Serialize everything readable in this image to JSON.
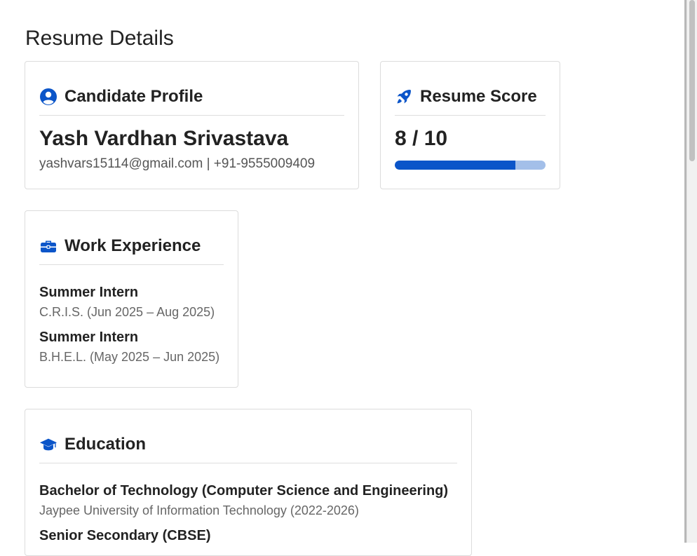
{
  "page": {
    "title": "Resume Details"
  },
  "profile": {
    "header": "Candidate Profile",
    "name": "Yash Vardhan Srivastava",
    "contact": "yashvars15114@gmail.com | +91-9555009409"
  },
  "score": {
    "header": "Resume Score",
    "text": "8 / 10",
    "value": 8,
    "max": 10,
    "colors": {
      "fill": "#0b55c9",
      "track": "#a3bfe9"
    }
  },
  "experience": {
    "header": "Work Experience",
    "items": [
      {
        "role": "Summer Intern",
        "detail": "C.R.I.S. (Jun 2025 – Aug 2025)"
      },
      {
        "role": "Summer Intern",
        "detail": "B.H.E.L. (May 2025 – Jun 2025)"
      }
    ]
  },
  "education": {
    "header": "Education",
    "items": [
      {
        "degree": "Bachelor of Technology (Computer Science and Engineering)",
        "detail": "Jaypee University of Information Technology (2022-2026)"
      },
      {
        "degree": "Senior Secondary (CBSE)"
      }
    ]
  },
  "icons": {
    "profile": "user-circle-icon",
    "score": "rocket-icon",
    "experience": "briefcase-icon",
    "education": "graduation-cap-icon",
    "accent": "#0b55c9"
  }
}
